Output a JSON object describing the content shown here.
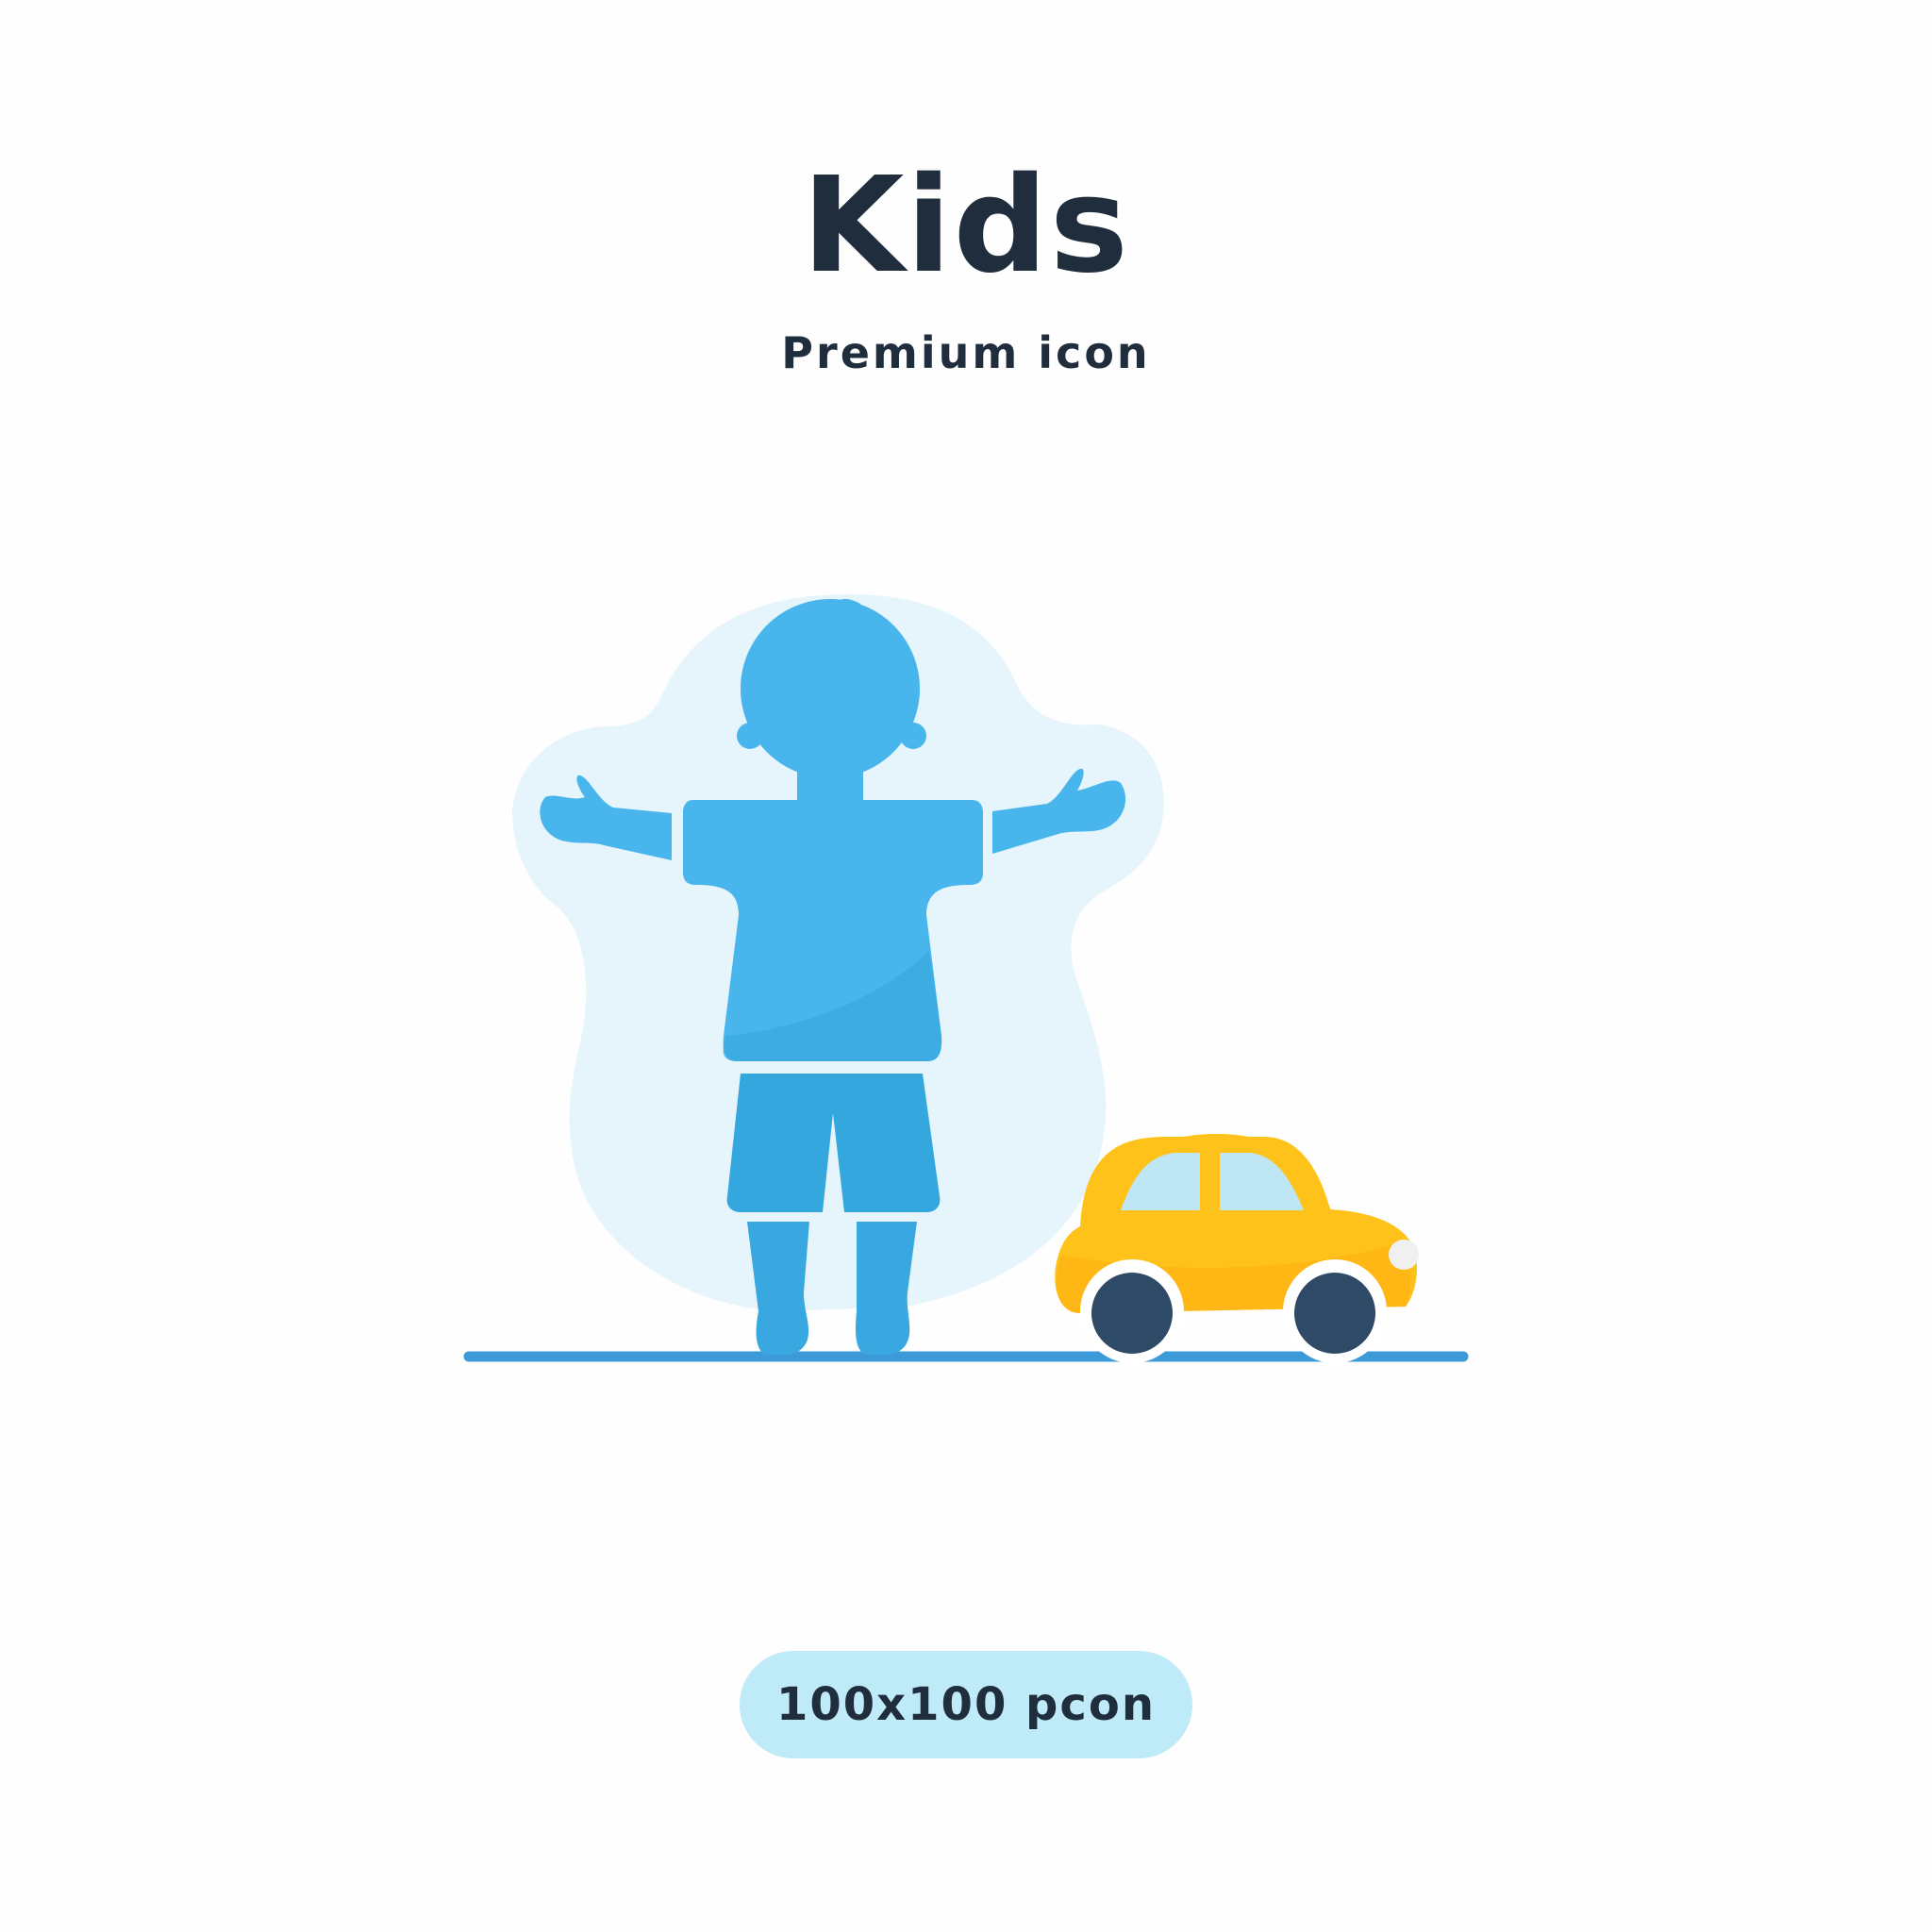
{
  "header": {
    "title": "Kids",
    "subtitle": "Premium icon"
  },
  "illustration": {
    "figure_icon": "child-arms-open-icon",
    "toy_icon": "toy-car-icon",
    "colors": {
      "blob": "#e6f5fb",
      "child": "#48b6ec",
      "child_shade": "#35a7df",
      "ground": "#3b9ad7",
      "car_body": "#ffc21a",
      "car_window": "#bfe6f5",
      "car_wheel": "#2f4a66"
    }
  },
  "badge": {
    "label": "100x100 pcon"
  }
}
